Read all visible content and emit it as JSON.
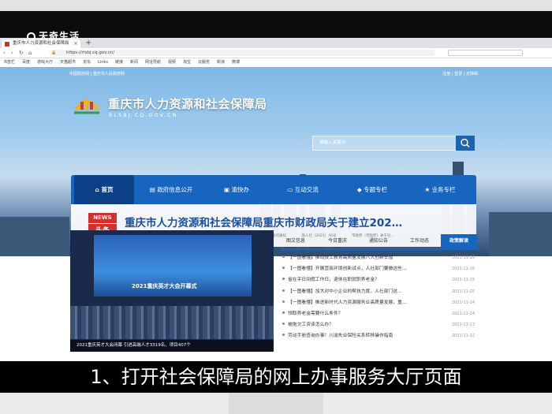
{
  "watermark": "天奇生活",
  "browser": {
    "tab_title": "重庆市人力资源和社会保障局",
    "url": "https://rlsbj.cq.gov.cn/",
    "security": "您的连接安全",
    "bookmarks": [
      "书签栏",
      "百度",
      "游戏大厅",
      "天猫超市",
      "京东",
      "Links",
      "链接",
      "新闻",
      "网址导航",
      "视频",
      "淘宝",
      "云服务",
      "新浪",
      "微博"
    ]
  },
  "site": {
    "top_nav": "中国政府网 | 重庆市人民政府网",
    "top_links": "注册 | 登录 | 无障碍",
    "title": "重庆市人力资源和社会保障局",
    "subtitle": "RLSBJ.CQ.GOV.CN",
    "search_placeholder": "请输入关键词",
    "menu": [
      "首页",
      "政府信息公开",
      "渝快办",
      "互动交流",
      "专题专栏",
      "业务专栏"
    ],
    "news": {
      "badge_top": "NEWS",
      "badge_bottom": "头条",
      "headline": "重庆市人力资源和社会保障局重庆市财政局关于建立202…",
      "sublines": [
        "重庆市人力资源和社会保障局重庆市财政局",
        "关于建立2021年高技能人才培训基地的通知",
        "渝人社〔2021〕40号",
        "市政府（市政府）关于社…"
      ]
    },
    "photo": {
      "stage_text": "2021重庆英才大会开幕式",
      "caption": "2021重庆英才大会闭幕 引进高端人才3319名，项目407个"
    },
    "content_tabs": [
      "图文信息",
      "今日重庆",
      "通知公告",
      "工作动态",
      "政策解读"
    ],
    "list": [
      {
        "text": "【一图看懂】推动技工教育高质量发展八大创新举措",
        "date": "2021-11-29"
      },
      {
        "text": "【一图看懂】开展营商环境创新试点，人社部门要做这些…",
        "date": "2021-11-26"
      },
      {
        "text": "省在平日间假工作日，退休在职就职养老金？",
        "date": "2021-11-25"
      },
      {
        "text": "【一图看懂】加大对中小企业的帮扶力度，人社部门这…",
        "date": "2021-11-25"
      },
      {
        "text": "【一图看懂】推进新时代人力资源服务业高质量发展，重…",
        "date": "2021-11-24"
      },
      {
        "text": "领取养老金需要什么条件？",
        "date": "2021-11-24"
      },
      {
        "text": "被拖欠工资该怎么办？",
        "date": "2021-11-23"
      },
      {
        "text": "劳动手册查询办事！川渝失业保险关系转移操作指南",
        "date": "2021-11-22"
      }
    ]
  },
  "subtitle_caption": "1、打开社会保障局的网上办事服务大厅页面"
}
